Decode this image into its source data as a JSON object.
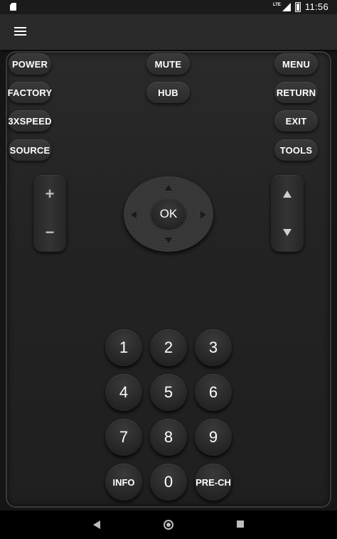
{
  "statusbar": {
    "network": "LTE",
    "time": "11:56"
  },
  "appbar": {
    "menu_icon": "hamburger-menu-icon"
  },
  "buttons": {
    "power": "POWER",
    "mute": "MUTE",
    "menu": "MENU",
    "factory": "FACTORY",
    "hub": "HUB",
    "return": "RETURN",
    "speed": "3XSPEED",
    "exit": "EXIT",
    "source": "SOURCE",
    "tools": "TOOLS"
  },
  "volume": {
    "up": "+",
    "down": "−"
  },
  "dpad": {
    "ok": "OK"
  },
  "keypad": {
    "k1": "1",
    "k2": "2",
    "k3": "3",
    "k4": "4",
    "k5": "5",
    "k6": "6",
    "k7": "7",
    "k8": "8",
    "k9": "9",
    "info": "INFO",
    "k0": "0",
    "prech": "PRE-CH"
  },
  "navbar": {
    "back": "back-icon",
    "home": "home-icon",
    "recents": "recents-icon"
  }
}
